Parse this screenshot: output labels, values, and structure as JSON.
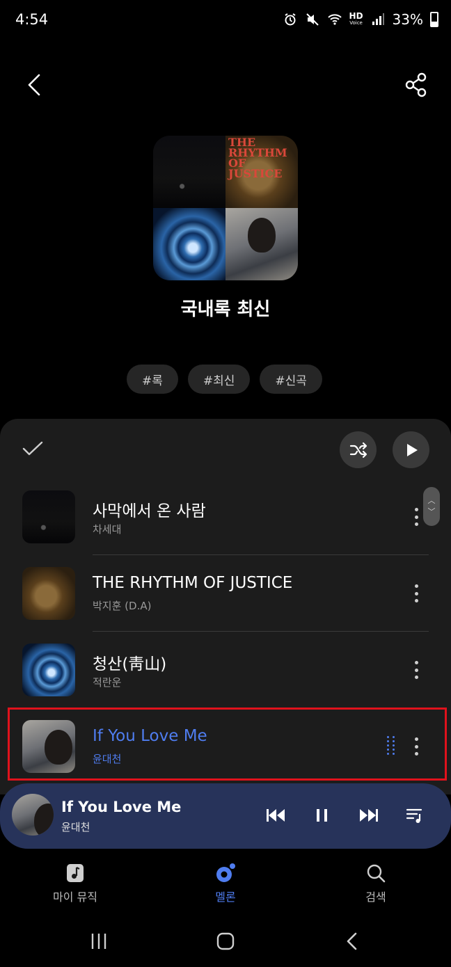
{
  "status_bar": {
    "time": "4:54",
    "network_label": "HD",
    "network_sublabel": "Voice",
    "battery": "33%"
  },
  "header": {
    "back_icon": "chevron-left-icon",
    "share_icon": "share-icon"
  },
  "playlist": {
    "title": "국내록 최신",
    "cover_text": "THE RHYTHM OF JUSTICE",
    "tags": [
      "#록",
      "#최신",
      "#신곡"
    ]
  },
  "list_controls": {
    "select_icon": "check-icon",
    "shuffle_icon": "shuffle-icon",
    "play_icon": "play-icon"
  },
  "songs": [
    {
      "title": "사막에서 온 사람",
      "artist": "차세대",
      "active": false
    },
    {
      "title": "THE RHYTHM OF JUSTICE",
      "artist": "박지훈 (D.A)",
      "active": false
    },
    {
      "title": "청산(靑山)",
      "artist": "적란운",
      "active": false
    },
    {
      "title": "If You Love Me",
      "artist": "윤대천",
      "active": true
    }
  ],
  "mini_player": {
    "title": "If You Love Me",
    "artist": "윤대천"
  },
  "bottom_nav": [
    {
      "label": "마이 뮤직",
      "icon": "music-note-icon",
      "active": false
    },
    {
      "label": "멜론",
      "icon": "melon-icon",
      "active": true
    },
    {
      "label": "검색",
      "icon": "search-icon",
      "active": false
    }
  ],
  "colors": {
    "accent": "#4f7df0",
    "sheet_bg": "#1c1c1c",
    "mini_player_bg": "#27335a",
    "highlight": "#e0121c"
  }
}
